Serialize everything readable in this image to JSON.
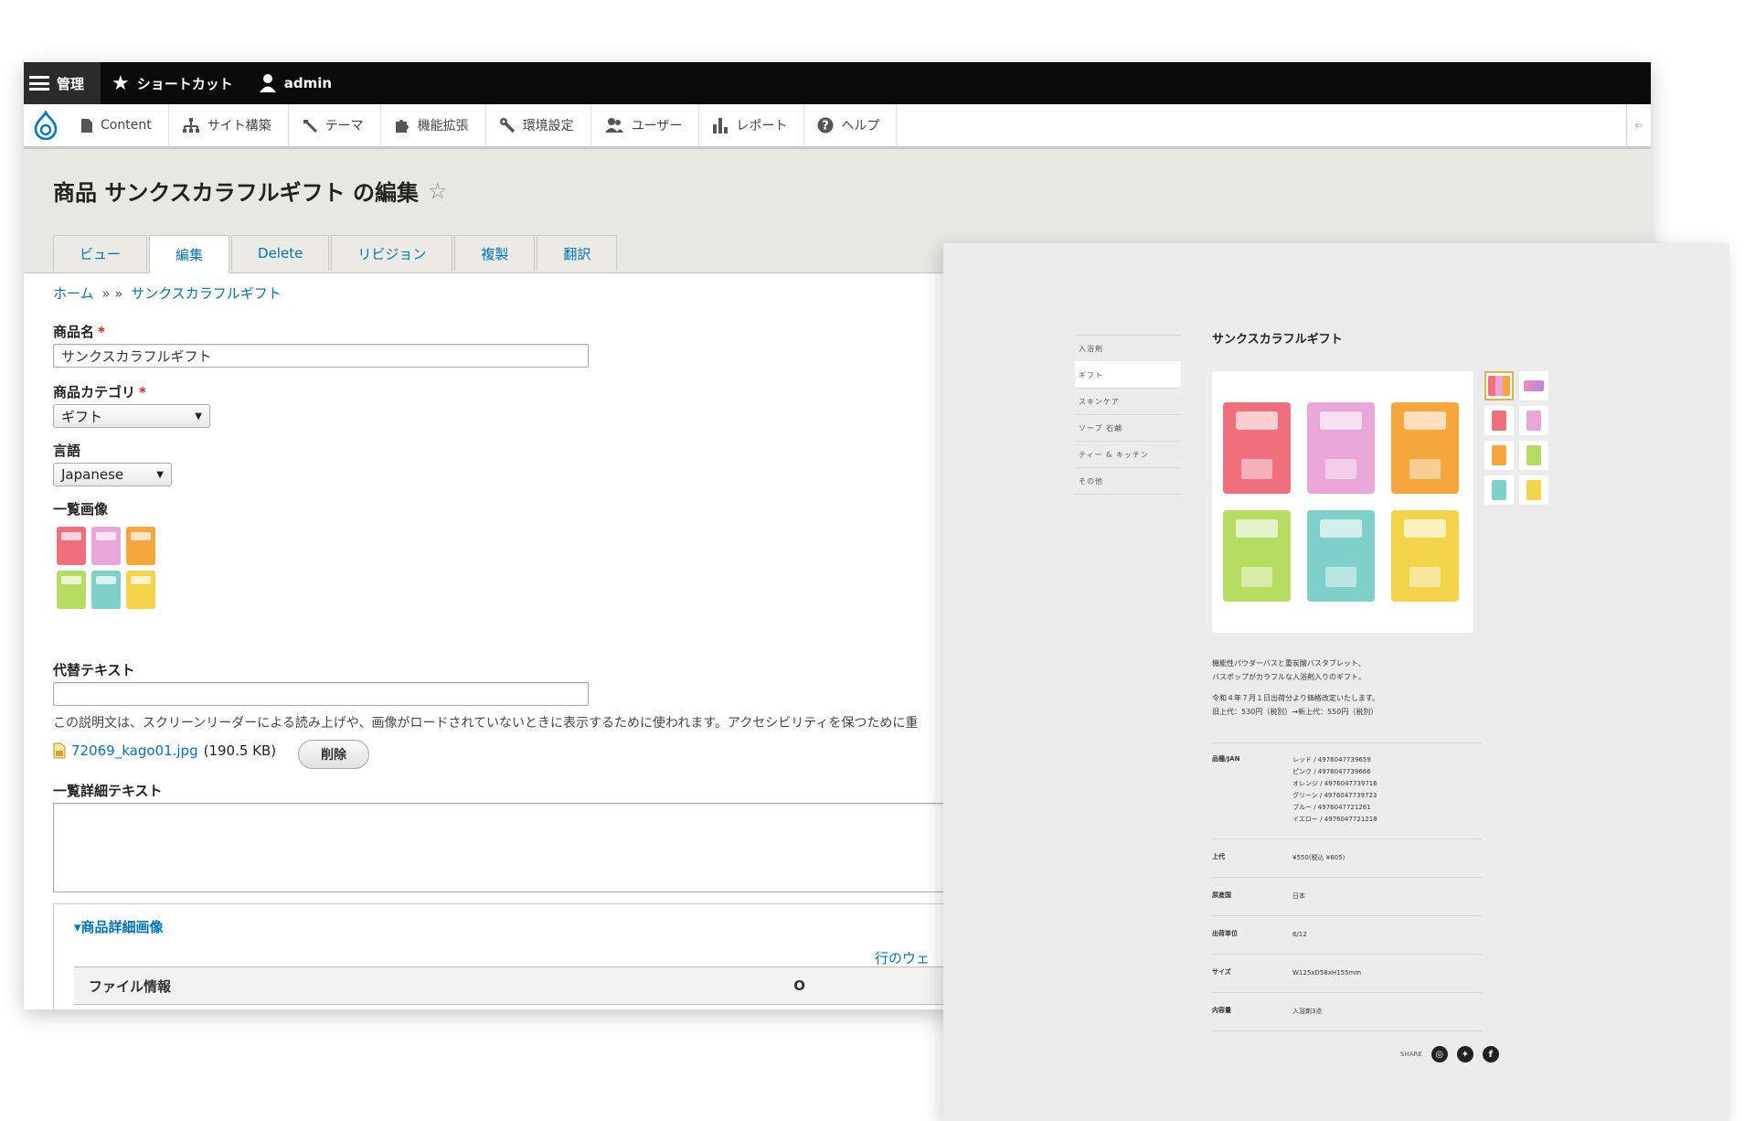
{
  "toolbar": {
    "manage": "管理",
    "shortcuts": "ショートカット",
    "user": "admin"
  },
  "tray": {
    "items": [
      "Content",
      "サイト構築",
      "テーマ",
      "機能拡張",
      "環境設定",
      "ユーザー",
      "レポート",
      "ヘルプ"
    ],
    "end": "⇐"
  },
  "page": {
    "title": "商品 サンクスカラフルギフト の編集",
    "tabs": [
      "ビュー",
      "編集",
      "Delete",
      "リビジョン",
      "複製",
      "翻訳"
    ],
    "active_tab": "編集"
  },
  "breadcrumb": {
    "home": "ホーム",
    "sep": "» »",
    "current": "サンクスカラフルギフト"
  },
  "form": {
    "product_name_label": "商品名",
    "required_mark": "*",
    "product_name_value": "サンクスカラフルギフト",
    "category_label": "商品カテゴリ",
    "category_value": "ギフト",
    "language_label": "言語",
    "language_value": "Japanese",
    "list_image_label": "一覧画像",
    "alt_text_label": "代替テキスト",
    "alt_text_value": "",
    "alt_description": "この説明文は、スクリーンリーダーによる読み上げや、画像がロードされていないときに表示するために使われます。アクセシビリティを保つために重",
    "file_name": "72069_kago01.jpg",
    "file_size": "(190.5 KB)",
    "remove_button": "削除",
    "list_detail_text_label": "一覧詳細テキスト",
    "detail_images_legend": "▾商品詳細画像",
    "row_weights_link": "行のウェ",
    "file_info_header": "ファイル情報",
    "op_header": "O"
  },
  "preview": {
    "nav": [
      "入浴剤",
      "ギフト",
      "スキンケア",
      "ソープ 石鹸",
      "ティー & キッチン",
      "その他"
    ],
    "active_nav": "ギフト",
    "title": "サンクスカラフルギフト",
    "description": [
      "機能性パウダーバスと重炭酸バスタブレット、",
      "バスポップがカラフルな入浴剤入りのギフト。",
      "",
      "令和４年７月１日出荷分より価格改定いたします。",
      "旧上代：530円（税別）→新上代：550円（税別）"
    ],
    "specs": [
      {
        "key": "品種/JAN",
        "values": [
          "レッド / 4976047739659",
          "ピンク / 4976047739666",
          "オレンジ / 4976047739716",
          "グリーン / 4976047739723",
          "ブルー / 4976047721261",
          "イエロー / 4976047721218"
        ]
      },
      {
        "key": "上代",
        "values": [
          "¥550(税込 ¥605)"
        ]
      },
      {
        "key": "原産国",
        "values": [
          "日本"
        ]
      },
      {
        "key": "出荷単位",
        "values": [
          "6/12"
        ]
      },
      {
        "key": "サイズ",
        "values": [
          "W125xD58xH155mm"
        ]
      },
      {
        "key": "内容量",
        "values": [
          "入浴剤3点"
        ]
      }
    ],
    "share_label": "SHARE",
    "colors": {
      "red": "#ef6f7c",
      "pink": "#e9a6d8",
      "orange": "#f5a63c",
      "green": "#b6dc62",
      "blue": "#7fd0c9",
      "yellow": "#f3d34a"
    }
  }
}
